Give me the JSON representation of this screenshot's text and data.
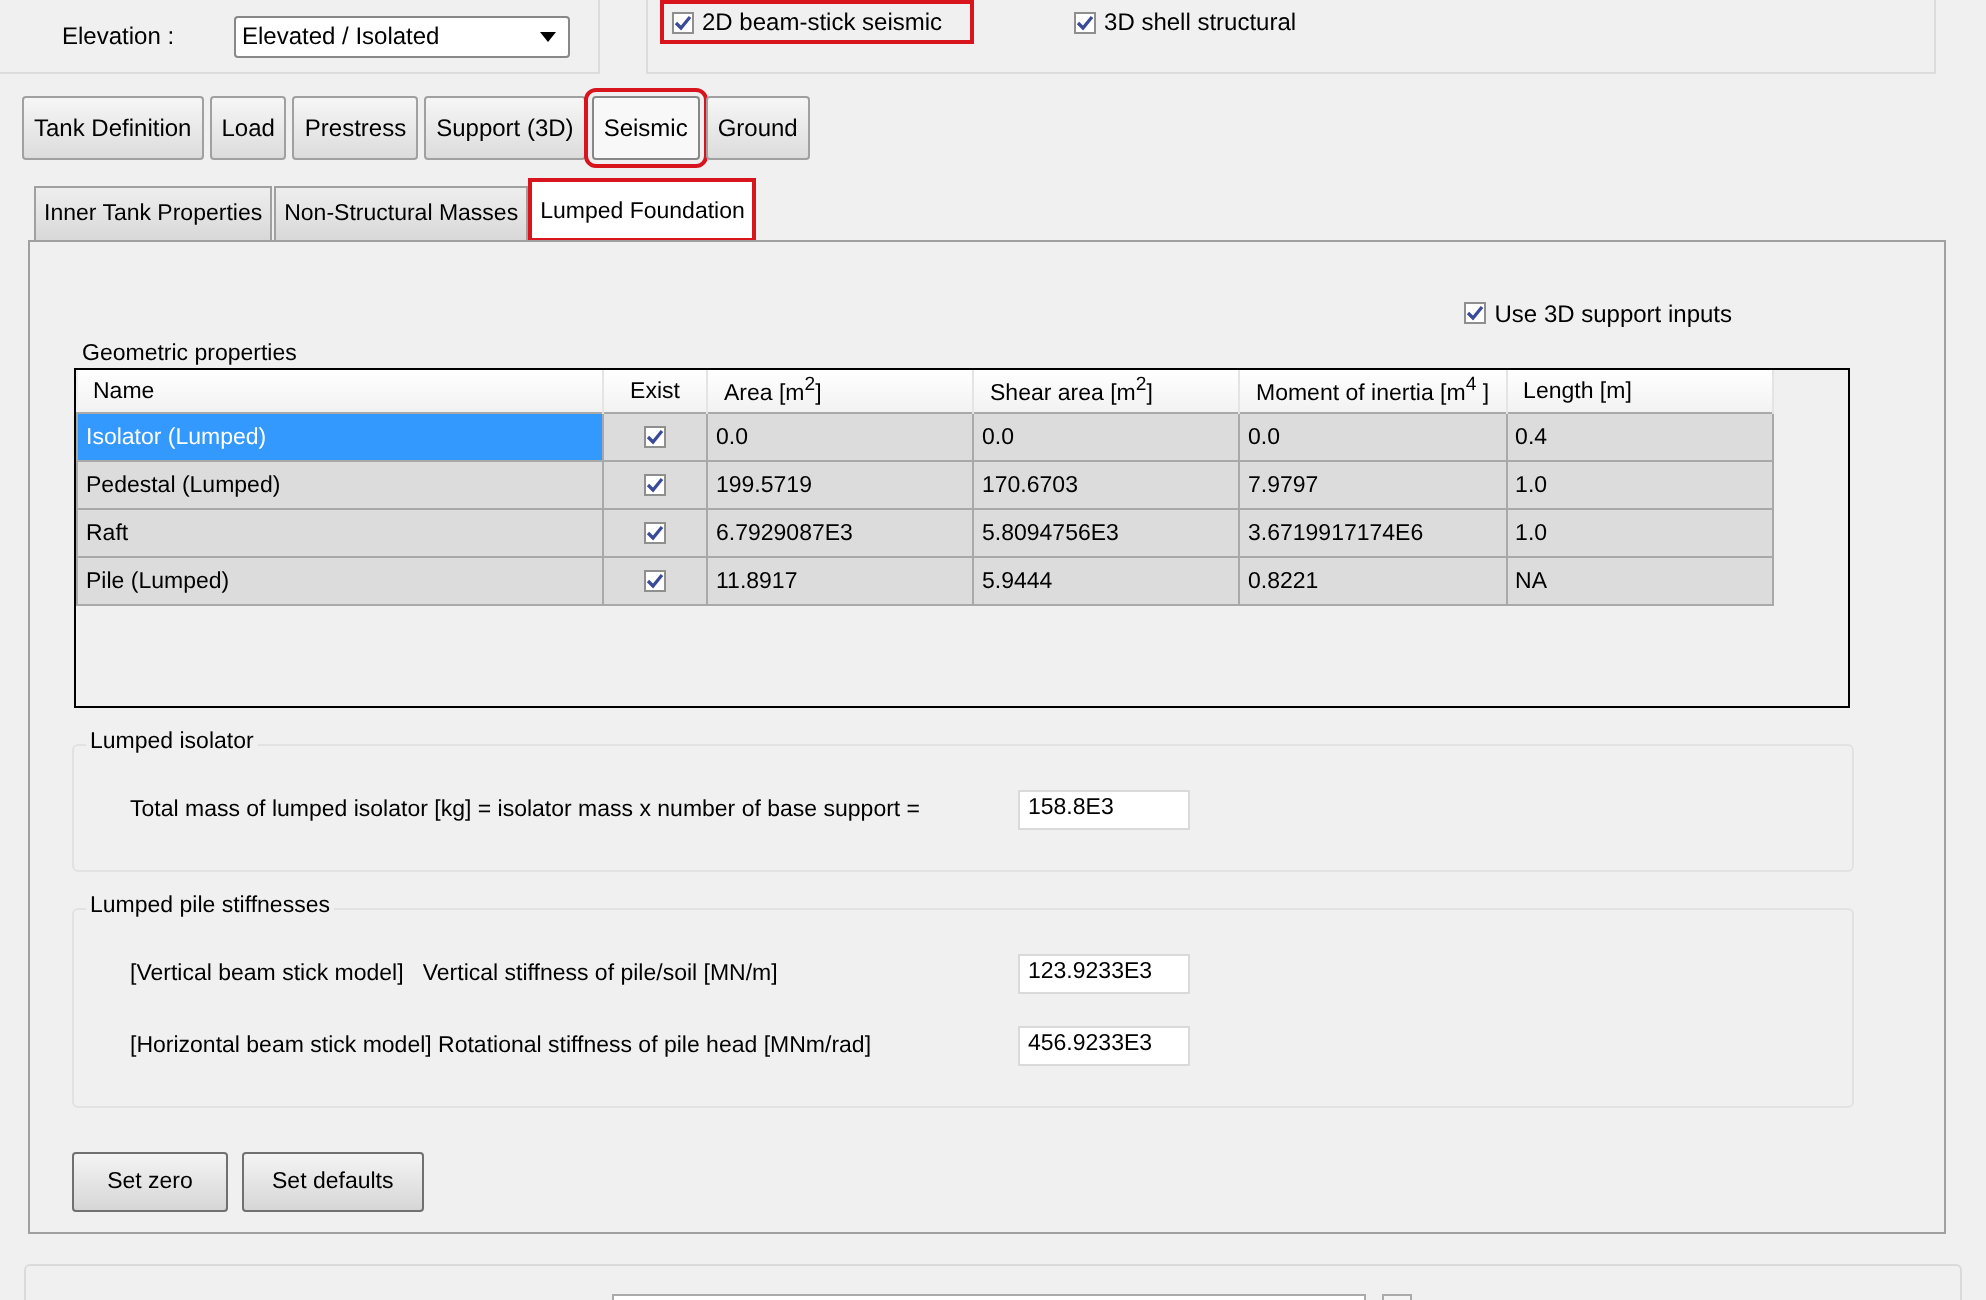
{
  "top": {
    "elevation_label": "Elevation :",
    "elevation_value": "Elevated / Isolated",
    "options": [
      {
        "label": "2D beam-stick seismic",
        "checked": true,
        "highlighted": true
      },
      {
        "label": "3D shell structural",
        "checked": true,
        "highlighted": false
      }
    ]
  },
  "tabs": [
    {
      "label": "Tank Definition",
      "selected": false,
      "highlighted": false
    },
    {
      "label": "Load",
      "selected": false,
      "highlighted": false
    },
    {
      "label": "Prestress",
      "selected": false,
      "highlighted": false
    },
    {
      "label": "Support (3D)",
      "selected": false,
      "highlighted": false
    },
    {
      "label": "Seismic",
      "selected": true,
      "highlighted": true
    },
    {
      "label": "Ground",
      "selected": false,
      "highlighted": false
    }
  ],
  "subtabs": [
    {
      "label": "Inner Tank Properties",
      "selected": false,
      "highlighted": false
    },
    {
      "label": "Non-Structural Masses",
      "selected": false,
      "highlighted": false
    },
    {
      "label": "Lumped Foundation",
      "selected": true,
      "highlighted": true
    }
  ],
  "use_3d": {
    "label": "Use 3D support inputs",
    "checked": true
  },
  "geometric": {
    "title": "Geometric properties",
    "columns": [
      "Name",
      "Exist",
      "Area [m$^{2}$]",
      "Shear area [m$^{2}$]",
      "Moment of inertia [m$^{4}$ ]",
      "Length [m]"
    ],
    "rows": [
      {
        "selected": true,
        "name": "Isolator (Lumped)",
        "exist": true,
        "area": "0.0",
        "shear_area": "0.0",
        "moment_of_inertia": "0.0",
        "length": "0.4"
      },
      {
        "selected": false,
        "name": "Pedestal (Lumped)",
        "exist": true,
        "area": "199.5719",
        "shear_area": "170.6703",
        "moment_of_inertia": "7.9797",
        "length": "1.0"
      },
      {
        "selected": false,
        "name": "Raft",
        "exist": true,
        "area": "6.7929087E3",
        "shear_area": "5.8094756E3",
        "moment_of_inertia": "3.6719917174E6",
        "length": "1.0"
      },
      {
        "selected": false,
        "name": "Pile (Lumped)",
        "exist": true,
        "area": "11.8917",
        "shear_area": "5.9444",
        "moment_of_inertia": "0.8221",
        "length": "NA"
      }
    ]
  },
  "groups": [
    {
      "title": "Lumped isolator",
      "fields": [
        {
          "label": "Total mass of lumped isolator [kg] = isolator mass x number of base support =",
          "value": "158.8E3"
        }
      ]
    },
    {
      "title": "Lumped pile stiffnesses",
      "fields": [
        {
          "label": "[Vertical beam stick model]   Vertical stiffness of pile/soil [MN/m]",
          "value": "123.9233E3"
        },
        {
          "label": "[Horizontal beam stick model] Rotational stiffness of pile head [MNm/rad]",
          "value": "456.9233E3"
        }
      ]
    }
  ],
  "buttons": [
    "Set zero",
    "Set defaults"
  ]
}
